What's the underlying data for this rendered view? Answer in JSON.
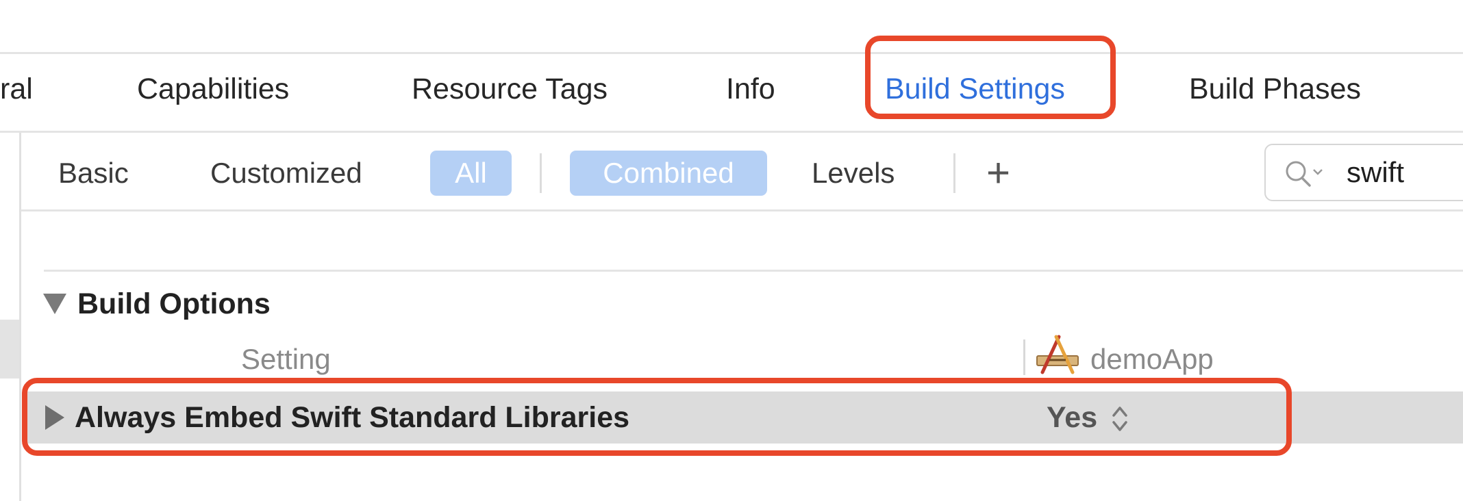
{
  "tabs": {
    "general_partial": "ral",
    "capabilities": "Capabilities",
    "resource_tags": "Resource Tags",
    "info": "Info",
    "build_settings": "Build Settings",
    "build_phases": "Build Phases"
  },
  "filter_bar": {
    "basic": "Basic",
    "customized": "Customized",
    "all": "All",
    "combined": "Combined",
    "levels": "Levels",
    "add": "+"
  },
  "search": {
    "value": "swift",
    "icon": "search-icon"
  },
  "section": {
    "title": "Build Options",
    "setting_header": "Setting",
    "target_header": "demoApp",
    "target_icon": "app-target-icon"
  },
  "row": {
    "label": "Always Embed Swift Standard Libraries",
    "value": "Yes"
  },
  "colors": {
    "accent": "#2f6fdc",
    "selected_segment": "#b5d0f5",
    "highlight_box": "#e8472a",
    "row_background": "#dcdcdc"
  }
}
